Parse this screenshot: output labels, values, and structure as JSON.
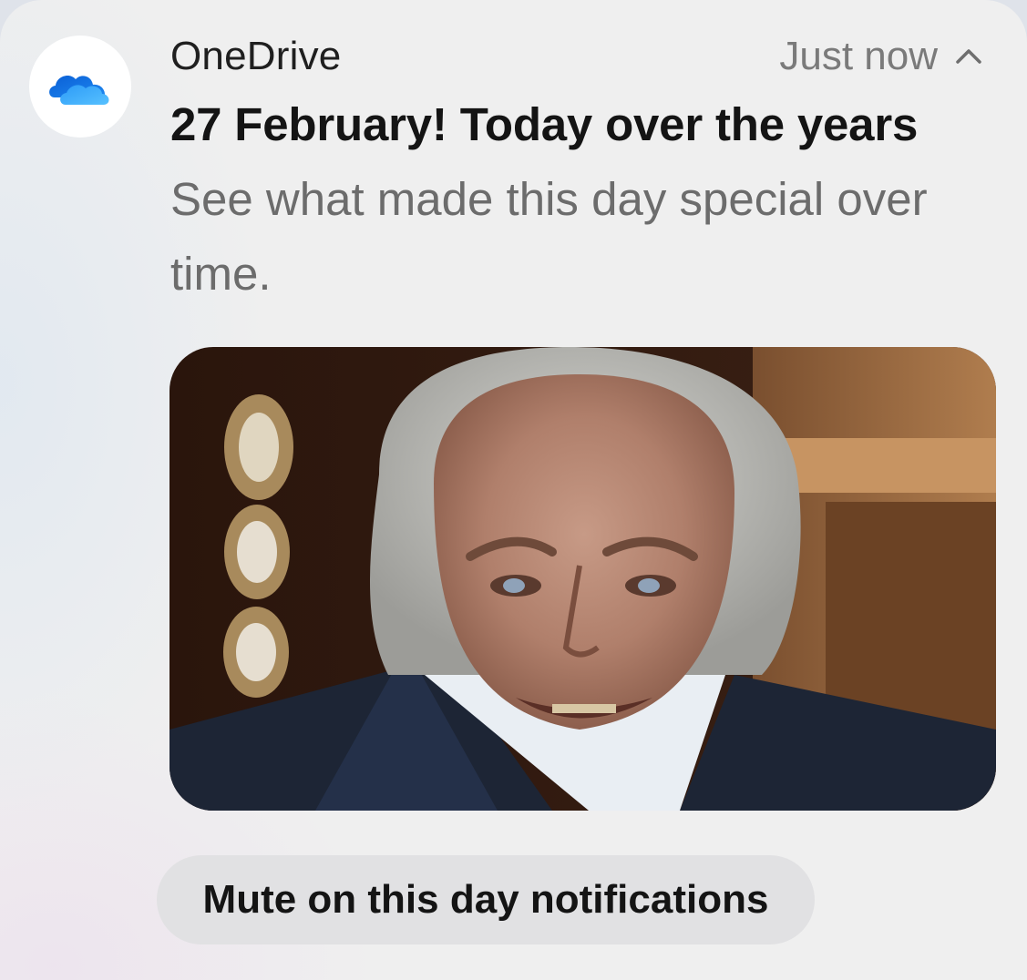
{
  "notification": {
    "app_name": "OneDrive",
    "app_icon": "onedrive-cloud-icon",
    "timestamp": "Just now",
    "expand_icon": "chevron-up-icon",
    "title": "27 February! Today over the years",
    "body": "See what made this day special over time.",
    "image": "memory-photo",
    "action_label": "Mute on this day notifications"
  },
  "colors": {
    "onedrive_blue": "#1a73e8",
    "onedrive_light": "#3fa9f5",
    "button_bg": "#e1e1e3"
  }
}
